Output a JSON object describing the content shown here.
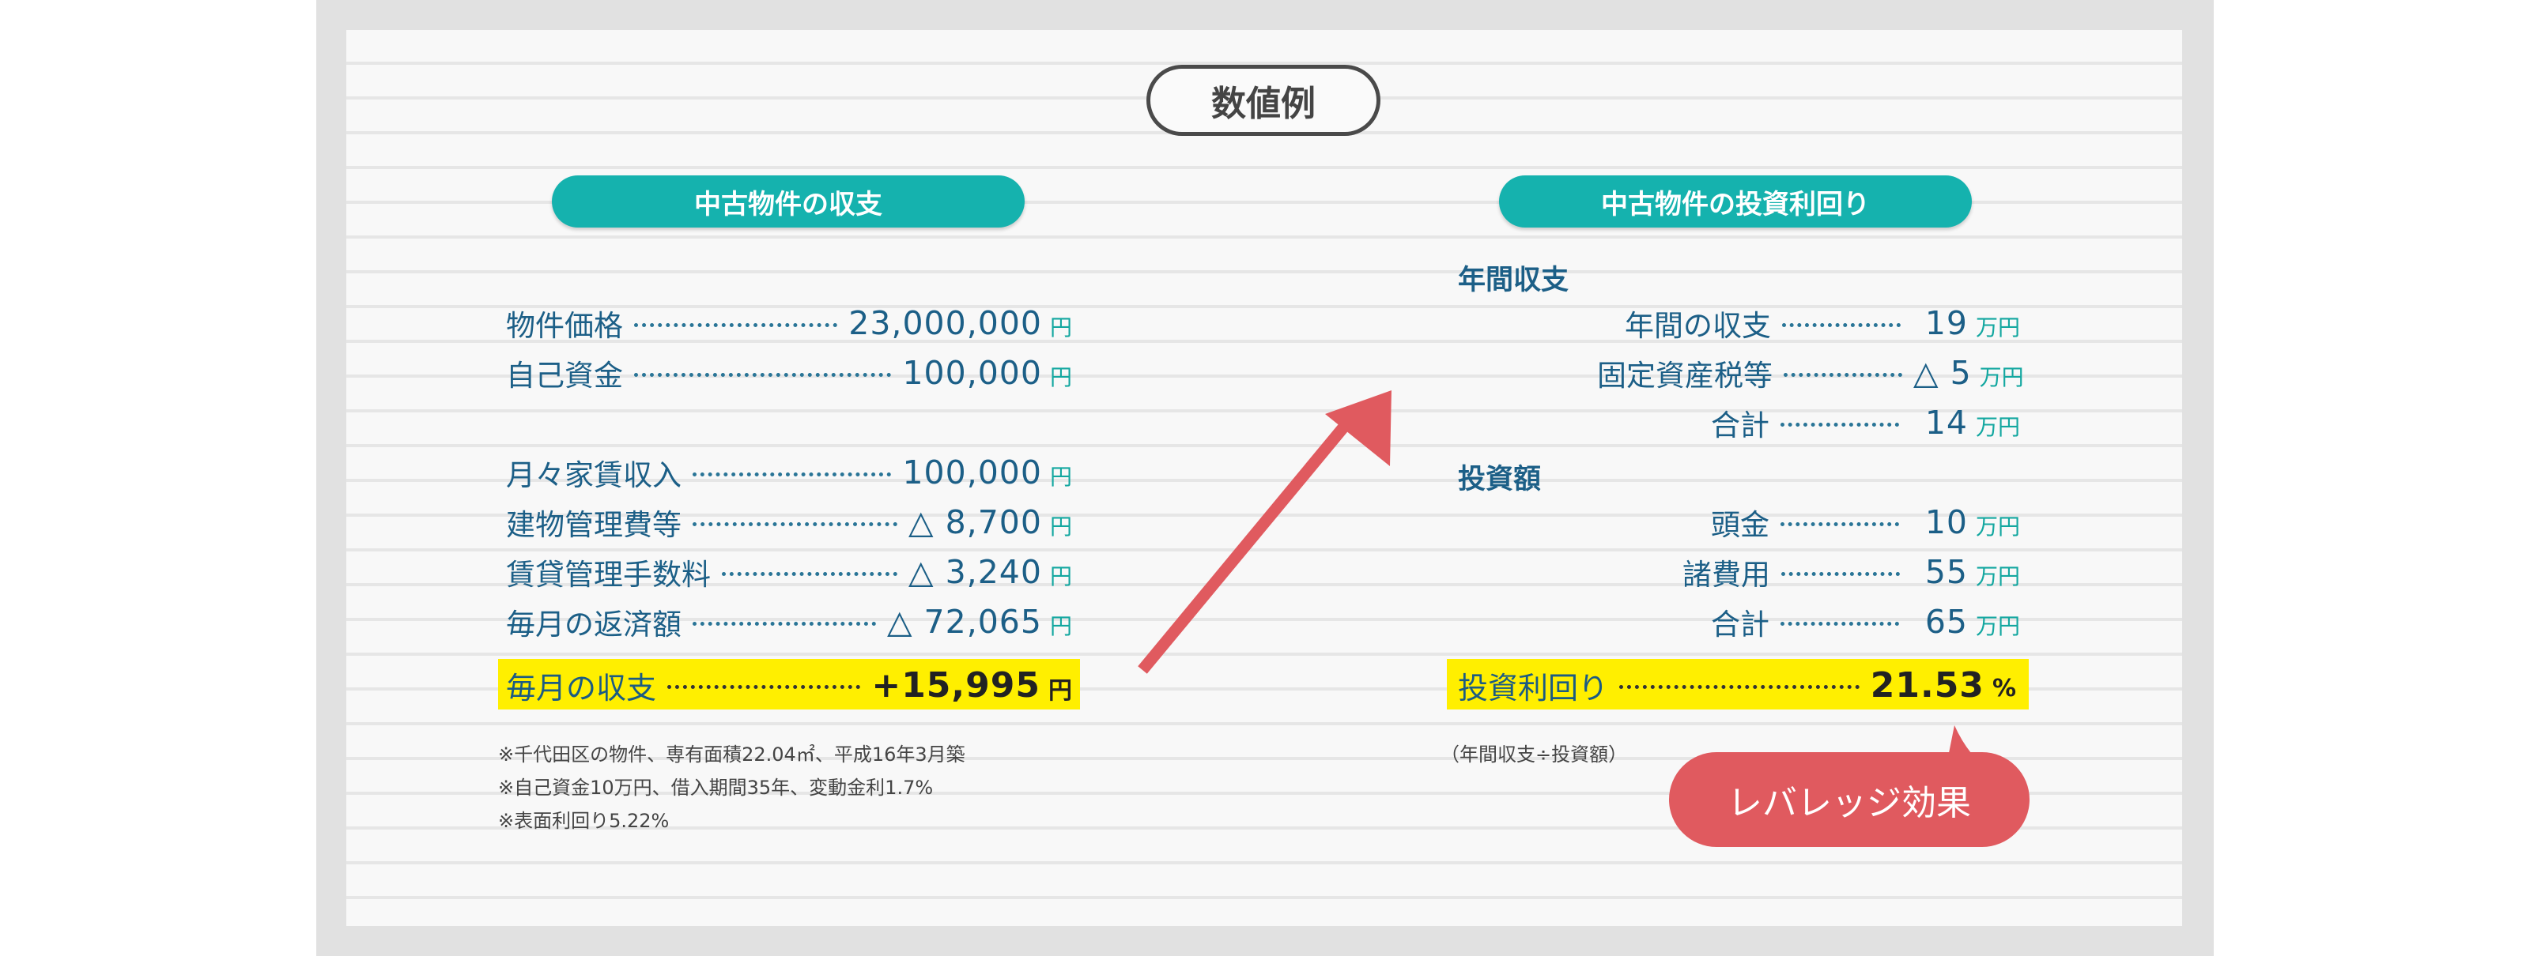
{
  "title": "数値例",
  "left": {
    "heading": "中古物件の収支",
    "rows": [
      {
        "label": "物件価格",
        "value": "23,000,000",
        "unit": "円"
      },
      {
        "label": "自己資金",
        "value": "100,000",
        "unit": "円"
      },
      {
        "label": "月々家賃収入",
        "value": "100,000",
        "unit": "円"
      },
      {
        "label": "建物管理費等",
        "value": "△ 8,700",
        "unit": "円"
      },
      {
        "label": "賃貸管理手数料",
        "value": "△ 3,240",
        "unit": "円"
      },
      {
        "label": "毎月の返済額",
        "value": "△ 72,065",
        "unit": "円"
      }
    ],
    "total": {
      "label": "毎月の収支",
      "value": "+15,995",
      "unit": "円"
    },
    "notes": [
      "※千代田区の物件、専有面積22.04㎡、平成16年3月築",
      "※自己資金10万円、借入期間35年、変動金利1.7%",
      "※表面利回り5.22%"
    ]
  },
  "right": {
    "heading": "中古物件の投資利回り",
    "annual_heading": "年間収支",
    "annual_rows": [
      {
        "label": "年間の収支",
        "value": "19",
        "unit": "万円"
      },
      {
        "label": "固定資産税等",
        "value": "△ 5",
        "unit": "万円"
      },
      {
        "label": "合計",
        "value": "14",
        "unit": "万円"
      }
    ],
    "invest_heading": "投資額",
    "invest_rows": [
      {
        "label": "頭金",
        "value": "10",
        "unit": "万円"
      },
      {
        "label": "諸費用",
        "value": "55",
        "unit": "万円"
      },
      {
        "label": "合計",
        "value": "65",
        "unit": "万円"
      }
    ],
    "total": {
      "label": "投資利回り",
      "value": "21.53",
      "unit": "%"
    },
    "note": "（年間収支÷投資額）",
    "bubble": "レバレッジ効果"
  },
  "colors": {
    "accent": "#15b2ae",
    "highlight": "#ffef00",
    "bubble": "#e05a5f",
    "text": "#1c5f87"
  }
}
